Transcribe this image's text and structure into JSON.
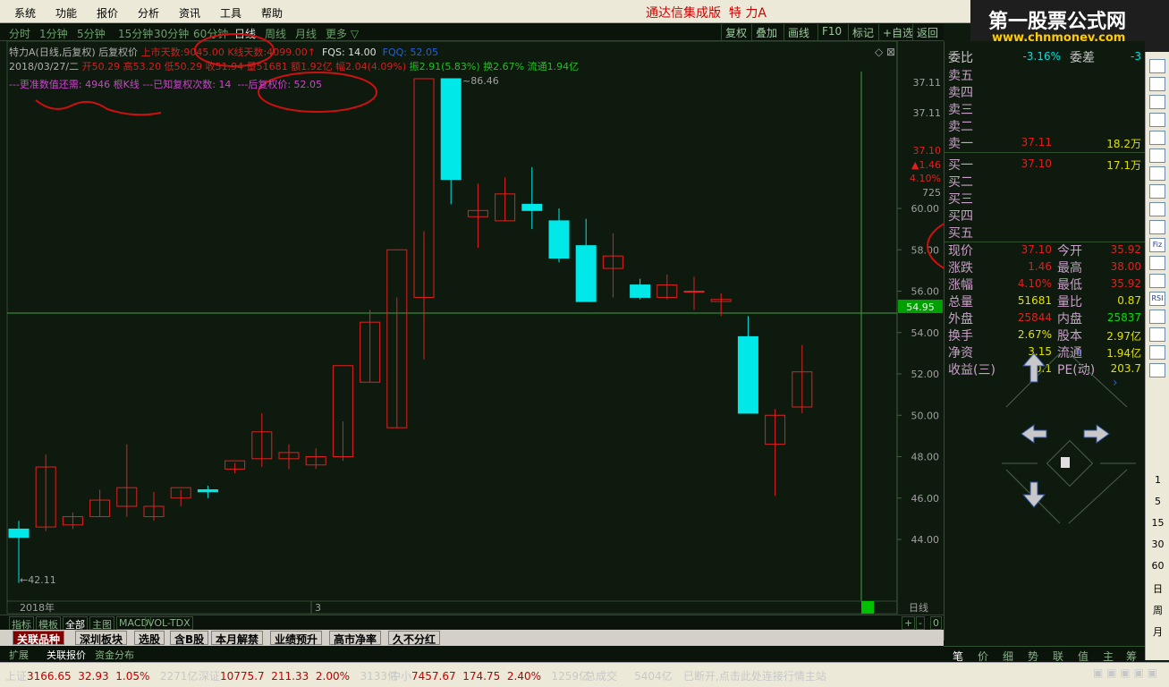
{
  "menu": {
    "items": [
      "系统",
      "功能",
      "报价",
      "分析",
      "资讯",
      "工具",
      "帮助"
    ],
    "app_title": "通达信集成版",
    "stock_title": "特 力A"
  },
  "logo": {
    "main": "第一股票公式网",
    "url": "www.chnmoney.com"
  },
  "periods": [
    "分时",
    "1分钟",
    "5分钟",
    "15分钟",
    "30分钟",
    "60分钟",
    "日线",
    "周线",
    "月线",
    "更多"
  ],
  "period_active": "日线",
  "toolbar": [
    "复权",
    "叠加",
    "画线",
    "F10",
    "标记",
    "+自选",
    "返回"
  ],
  "info": {
    "line1": {
      "name": "特力A",
      "mode": "(日线,后复权)",
      "mode2": "后复权价",
      "list_days_label": "上市天数:",
      "list_days": "9045.00",
      "kline_label": "K线天数:",
      "kline_days": "4099.00",
      "fqs": "FQS: 14.00",
      "fqq": "FQQ: 52.05"
    },
    "line2": {
      "date": "2018/03/27/二",
      "open": "开50.29",
      "high": "高53.20",
      "low": "低50.29",
      "close": "收51.94",
      "vol": "量51681",
      "amount": "额1.92亿",
      "change": "幅2.04(4.09%)",
      "amplitude": "振2.91(5.83%)",
      "turnover": "换2.67%",
      "float": "流通1.94亿"
    },
    "line3": {
      "a": "---更准数值还需: 4946 根K线",
      "b": "---已知复权次数: 14",
      "c": "---后复权价: 52.05"
    }
  },
  "chart_data": {
    "type": "candlestick",
    "title": "",
    "y_ticks": [
      44.0,
      46.0,
      48.0,
      50.0,
      52.0,
      54.0,
      56.0,
      58.0,
      60.0,
      72.5,
      37.11,
      37.1
    ],
    "ylim": [
      42.0,
      64.0
    ],
    "current_price_label": "54.95",
    "max_label": "86.46",
    "min_label": "42.11",
    "x_labels": [
      "2018年",
      "3"
    ],
    "right_labels": {
      "price": "37.10",
      "change": "▲1.46",
      "pct": "4.10%",
      "p725": "725",
      "p3711": "37.11"
    },
    "candles": [
      {
        "o": 44.5,
        "h": 44.9,
        "l": 41.9,
        "c": 44.1
      },
      {
        "o": 44.6,
        "h": 48.1,
        "l": 44.4,
        "c": 47.5
      },
      {
        "o": 44.7,
        "h": 45.3,
        "l": 44.5,
        "c": 45.1
      },
      {
        "o": 45.1,
        "h": 46.4,
        "l": 45.1,
        "c": 45.9
      },
      {
        "o": 45.6,
        "h": 48.6,
        "l": 45.1,
        "c": 46.5
      },
      {
        "o": 45.1,
        "h": 46.3,
        "l": 44.9,
        "c": 45.6
      },
      {
        "o": 46.0,
        "h": 46.4,
        "l": 45.6,
        "c": 46.5
      },
      {
        "o": 46.4,
        "h": 46.6,
        "l": 46.0,
        "c": 46.3
      },
      {
        "o": 47.4,
        "h": 47.7,
        "l": 47.2,
        "c": 47.8
      },
      {
        "o": 47.9,
        "h": 50.1,
        "l": 47.5,
        "c": 49.2
      },
      {
        "o": 47.9,
        "h": 48.6,
        "l": 47.4,
        "c": 48.2
      },
      {
        "o": 47.6,
        "h": 48.4,
        "l": 47.4,
        "c": 48.0
      },
      {
        "o": 48.0,
        "h": 49.7,
        "l": 47.8,
        "c": 52.4
      },
      {
        "o": 51.6,
        "h": 55.1,
        "l": 51.6,
        "c": 54.5
      },
      {
        "o": 49.4,
        "h": 55.7,
        "l": 49.4,
        "c": 58.0
      },
      {
        "o": 55.7,
        "h": 58.9,
        "l": 52.7,
        "c": 62.9
      },
      {
        "o": 63.1,
        "h": 86.46,
        "l": 60.2,
        "c": 61.4
      },
      {
        "o": 59.6,
        "h": 61.2,
        "l": 58.1,
        "c": 59.9
      },
      {
        "o": 59.4,
        "h": 61.5,
        "l": 59.4,
        "c": 60.7
      },
      {
        "o": 60.2,
        "h": 62.0,
        "l": 59.0,
        "c": 59.9
      },
      {
        "o": 59.4,
        "h": 60.0,
        "l": 57.4,
        "c": 57.6
      },
      {
        "o": 58.2,
        "h": 59.5,
        "l": 56.0,
        "c": 55.5
      },
      {
        "o": 57.1,
        "h": 58.8,
        "l": 55.7,
        "c": 57.7
      },
      {
        "o": 56.3,
        "h": 56.6,
        "l": 55.6,
        "c": 55.7
      },
      {
        "o": 55.7,
        "h": 56.8,
        "l": 55.6,
        "c": 56.3
      },
      {
        "o": 56.0,
        "h": 56.7,
        "l": 55.1,
        "c": 56.0
      },
      {
        "o": 55.5,
        "h": 55.9,
        "l": 54.8,
        "c": 55.6
      },
      {
        "o": 53.8,
        "h": 54.8,
        "l": 50.1,
        "c": 50.1
      },
      {
        "o": 48.6,
        "h": 50.3,
        "l": 46.1,
        "c": 50.0
      },
      {
        "o": 50.4,
        "h": 53.4,
        "l": 50.1,
        "c": 52.1
      }
    ]
  },
  "quote": {
    "weibi_label": "委比",
    "weibi": "-3.16%",
    "weicha_label": "委差",
    "weicha": "-3",
    "sell": [
      {
        "label": "卖五",
        "price": "",
        "vol": ""
      },
      {
        "label": "卖四",
        "price": "",
        "vol": ""
      },
      {
        "label": "卖三",
        "price": "",
        "vol": ""
      },
      {
        "label": "卖二",
        "price": "",
        "vol": ""
      },
      {
        "label": "卖一",
        "price": "37.11",
        "vol": "18.2万"
      }
    ],
    "buy": [
      {
        "label": "买一",
        "price": "37.10",
        "vol": "17.1万"
      },
      {
        "label": "买二",
        "price": "",
        "vol": ""
      },
      {
        "label": "买三",
        "price": "",
        "vol": ""
      },
      {
        "label": "买四",
        "price": "",
        "vol": ""
      },
      {
        "label": "买五",
        "price": "",
        "vol": ""
      }
    ],
    "rows": [
      {
        "l1": "现价",
        "v1": "37.10",
        "l2": "今开",
        "v2": "35.92"
      },
      {
        "l1": "涨跌",
        "v1": "1.46",
        "l2": "最高",
        "v2": "38.00"
      },
      {
        "l1": "涨幅",
        "v1": "4.10%",
        "l2": "最低",
        "v2": "35.92"
      },
      {
        "l1": "总量",
        "v1": "51681",
        "l2": "量比",
        "v2": "0.87"
      },
      {
        "l1": "外盘",
        "v1": "25844",
        "l2": "内盘",
        "v2": "25837"
      },
      {
        "l1": "换手",
        "v1": "2.67%",
        "l2": "股本",
        "v2": "2.97亿"
      },
      {
        "l1": "净资",
        "v1": "3.15",
        "l2": "流通",
        "v2": "1.94亿"
      },
      {
        "l1": "收益(三)",
        "v1": "0.1",
        "l2": "PE(动)",
        "v2": "203.7"
      }
    ]
  },
  "right_toolbar": {
    "icons": [
      "chart-icon",
      "bar-icon",
      "candle-icon",
      "tick-icon",
      "trend-icon",
      "detail-icon",
      "list-icon",
      "news-icon",
      "fin-icon",
      "f10-icon",
      "fiz-icon",
      "f_s-icon",
      "circle-icon",
      "rsi-icon",
      "percent-icon",
      "wave-icon",
      "f5-icon",
      "box-icon"
    ],
    "nums": [
      "1",
      "5",
      "15",
      "30",
      "60",
      "日",
      "周",
      "月"
    ],
    "rsi": "RSI",
    "fiz": "Fiz"
  },
  "bottom1": [
    "指标",
    "模板",
    "全部",
    "主图",
    "MACD",
    "VOL-TDX"
  ],
  "bottom2": [
    "关联品种",
    "深圳板块",
    "选股",
    "含B股",
    "本月解禁",
    "业绩预升",
    "高市净率",
    "久不分红"
  ],
  "bottom3": [
    "扩展",
    "关联报价",
    "资金分布"
  ],
  "quote_tabs": [
    "笔",
    "价",
    "细",
    "势",
    "联",
    "值",
    "主",
    "筹"
  ],
  "status": {
    "sh_label": "上证",
    "sh_val": "3166.65",
    "sh_chg": "32.93",
    "sh_pct": "1.05%",
    "sh_amt": "2271亿",
    "sz_label": "深证",
    "sz_val": "10775.7",
    "sz_chg": "211.33",
    "sz_pct": "2.00%",
    "sz_amt": "3133亿",
    "zx_label": "中小",
    "zx_val": "7457.67",
    "zx_chg": "174.75",
    "zx_pct": "2.40%",
    "zx_amt": "1259亿",
    "total_label": "总成交",
    "total": "5404亿",
    "msg": "已断开,点击此处连接行情主站"
  }
}
